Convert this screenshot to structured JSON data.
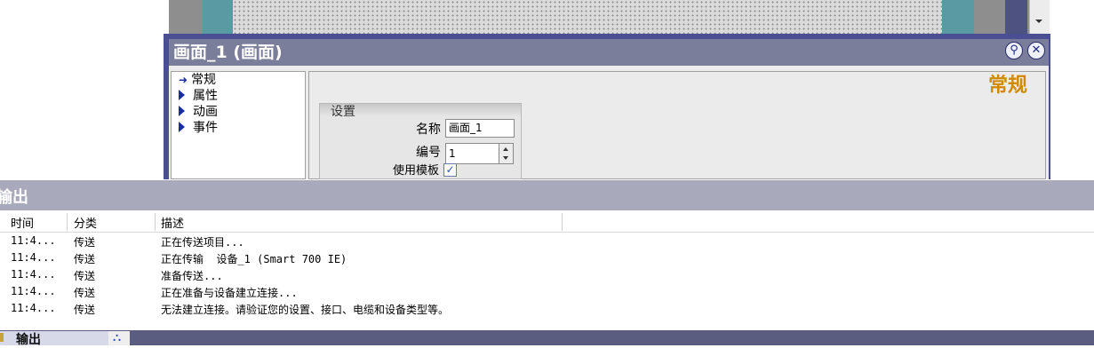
{
  "colors": {
    "canvas_gray": "#8e8e8e",
    "canvas_teal": "#5a9aa3",
    "canvas_grid": "#dadada",
    "panel_border": "#4a4f94",
    "title_bar": "#7a7e9b",
    "section_heading": "#d08a00",
    "output_header": "#a8a9bb",
    "tab_bar": "#5a5d80"
  },
  "properties_panel": {
    "title": "画面_1 (画面)",
    "pin_icon": "pin-icon",
    "close_icon": "close-icon",
    "nav": [
      {
        "label": "常规",
        "icon": "arrow-right-icon"
      },
      {
        "label": "属性",
        "icon": "triangle-right-icon"
      },
      {
        "label": "动画",
        "icon": "triangle-right-icon"
      },
      {
        "label": "事件",
        "icon": "triangle-right-icon"
      }
    ],
    "section_heading": "常规",
    "group": {
      "title": "设置",
      "name_label": "名称",
      "name_value": "画面_1",
      "number_label": "编号",
      "number_value": "1",
      "template_label": "使用模板",
      "template_checked": true
    }
  },
  "output": {
    "title": "输出",
    "columns": [
      "时间",
      "分类",
      "描述"
    ],
    "rows": [
      {
        "time": "11:4...",
        "category": "传送",
        "description": "正在传送项目..."
      },
      {
        "time": "11:4...",
        "category": "传送",
        "description": "正在传输  设备_1 (Smart 700 IE)"
      },
      {
        "time": "11:4...",
        "category": "传送",
        "description": "准备传送..."
      },
      {
        "time": "11:4...",
        "category": "传送",
        "description": "正在准备与设备建立连接..."
      },
      {
        "time": "11:4...",
        "category": "传送",
        "description": "无法建立连接。请验证您的设置、接口、电缆和设备类型等。"
      }
    ]
  },
  "tabs": [
    {
      "label": "输出",
      "active": true
    },
    {
      "label": "",
      "icon": "network-icon",
      "active": false
    }
  ]
}
